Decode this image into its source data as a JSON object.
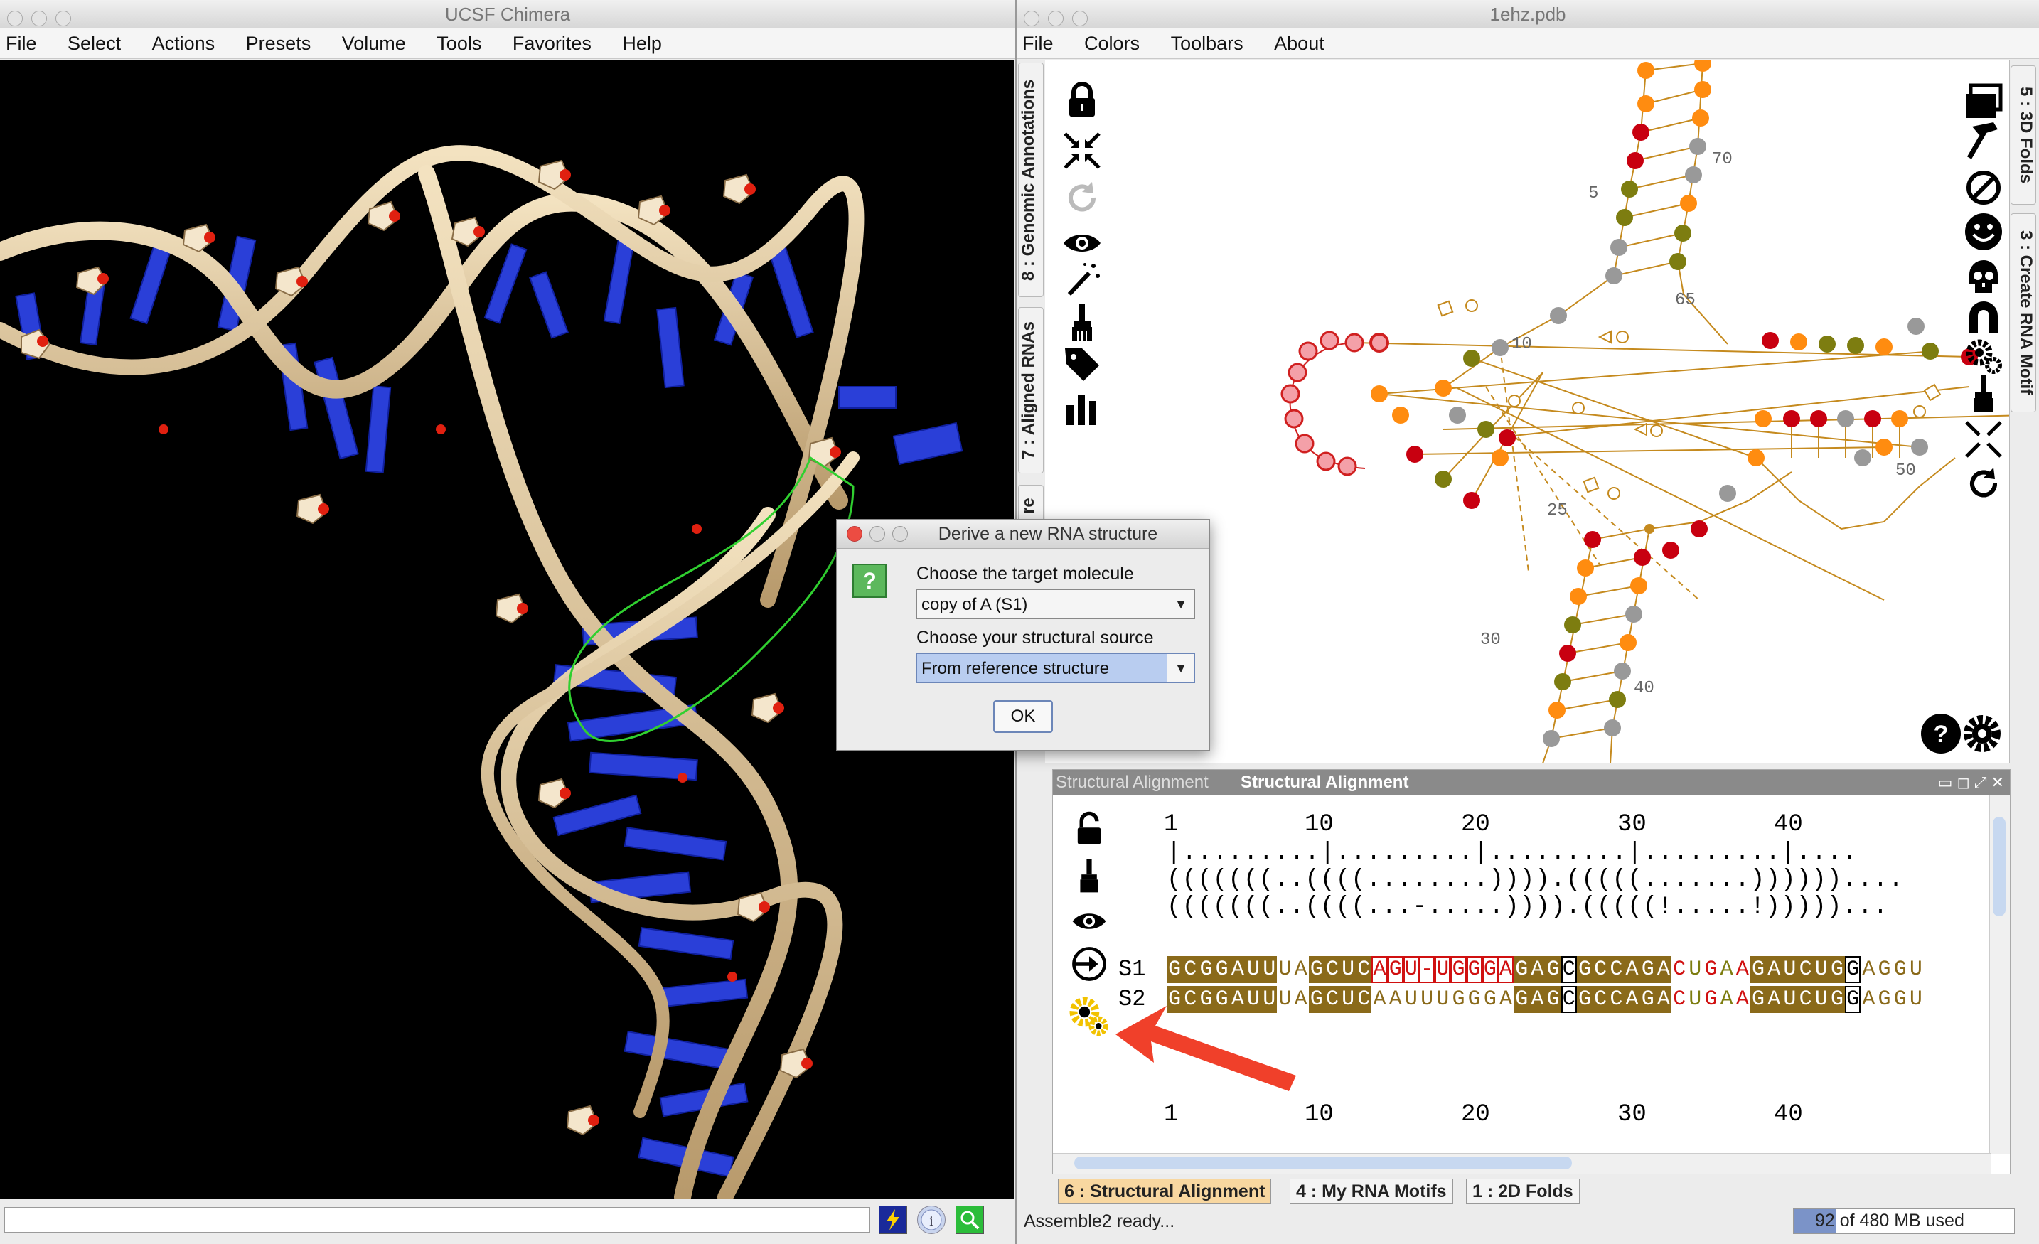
{
  "chimera": {
    "title": "UCSF Chimera",
    "menu": [
      "File",
      "Select",
      "Actions",
      "Presets",
      "Volume",
      "Tools",
      "Favorites",
      "Help"
    ],
    "command_value": ""
  },
  "assemble": {
    "title": "1ehz.pdb",
    "menu": [
      "File",
      "Colors",
      "Toolbars",
      "About"
    ],
    "left_tabs": [
      "8 : Genomic Annotations",
      "7 : Aligned RNAs",
      "re"
    ],
    "right_tabs": [
      "5 : 3D Folds",
      "3 : Create RNA Motif"
    ],
    "left_toolbar_icons": [
      "lock-icon",
      "compress-icon",
      "refresh-icon",
      "eye-icon",
      "magic-wand-icon",
      "paintbrush-icon",
      "tag-icon",
      "bar-chart-icon"
    ],
    "right_toolbar_icons": [
      "window-icon",
      "hammer-icon",
      "forbidden-icon",
      "smiley-icon",
      "skull-icon",
      "magnet-icon",
      "gears-icon",
      "paintbrush-icon",
      "compress-icon",
      "refresh-icon"
    ],
    "structure_numbers": [
      "5",
      "70",
      "65",
      "10",
      "50",
      "25",
      "30",
      "40"
    ],
    "help_icon": "question-icon",
    "settings_icon": "gear-icon"
  },
  "alignment_panel": {
    "tab_inactive": "Structural Alignment",
    "tab_active": "Structural Alignment",
    "ruler_numbers": [
      "1",
      "10",
      "20",
      "30",
      "40"
    ],
    "ruler_ticks": "|.........|.........|.........|.........|....",
    "structure_line_1": "(((((((..((((........)))).(((((.......))))))....",
    "structure_line_2": "(((((((..((((...-.....)))).(((((!.....!)))))...",
    "s1_label": "S1",
    "s2_label": "S2",
    "s1_sequence": "GCGGAUUUAGCUCAGU-UGGGAGAGCGCCAGACUGAAGAUCUGGAGGU",
    "s2_sequence": "GCGGAUUUAGCUCAAUUUGGGAGAGCGCCAGACUGAAGAUCUGGAGGU",
    "bottom_ruler_numbers": [
      "1",
      "10",
      "20",
      "30",
      "40"
    ]
  },
  "bottom_tabs": [
    "6 : Structural Alignment",
    "4 : My RNA Motifs",
    "1 : 2D Folds"
  ],
  "status": {
    "message": "Assemble2 ready...",
    "memory": "92 of 480 MB used"
  },
  "dialog": {
    "title": "Derive a new RNA structure",
    "label_target": "Choose the target molecule",
    "target_value": "copy of A (S1)",
    "label_source": "Choose your structural source",
    "source_value": "From reference structure",
    "ok_label": "OK",
    "icon_text": "?"
  },
  "colors": {
    "highlight_brown": "#8a6a1a",
    "highlight_red": "#d01010",
    "annotation_arrow": "#f0402a",
    "olive": "#7d7d10",
    "orange": "#ff8c10",
    "dark_red": "#c80010"
  }
}
